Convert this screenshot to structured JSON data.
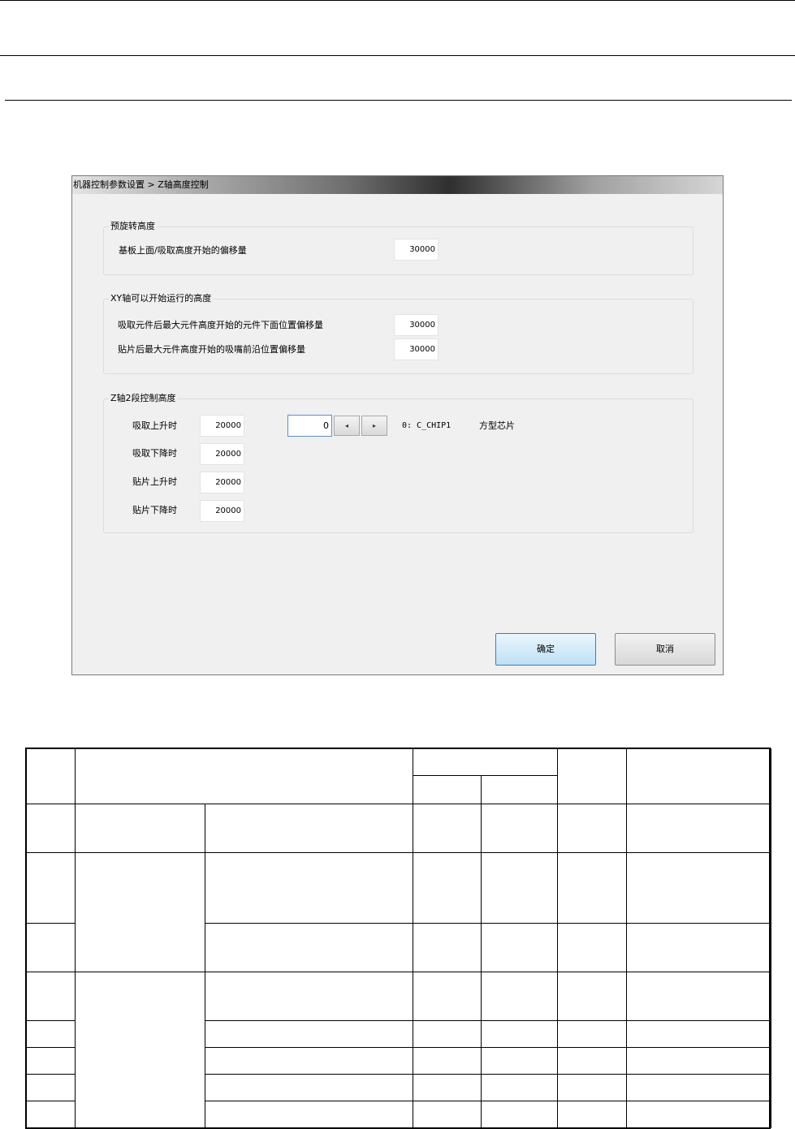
{
  "window": {
    "title": "机器控制参数设置 > Z轴高度控制"
  },
  "pre_rotation_group": {
    "label": "预旋转高度",
    "rows": [
      {
        "label": "基板上面/吸取高度开始的偏移量",
        "value": "30000"
      }
    ]
  },
  "xy_group": {
    "label": "XY轴可以开始运行的高度",
    "rows": [
      {
        "label": "吸取元件后最大元件高度开始的元件下面位置偏移量",
        "value": "30000"
      },
      {
        "label": "贴片后最大元件高度开始的吸嘴前沿位置偏移量",
        "value": "30000"
      }
    ]
  },
  "z2_group": {
    "label": "Z轴2段控制高度",
    "rows": [
      {
        "label": "吸取上升时",
        "value": "20000"
      },
      {
        "label": "吸取下降时",
        "value": "20000"
      },
      {
        "label": "贴片上升时",
        "value": "20000"
      },
      {
        "label": "贴片下降时",
        "value": "20000"
      }
    ],
    "spinner": {
      "value": "0",
      "prev_glyph": "◂",
      "next_glyph": "▸",
      "component_code": "0: C_CHIP1",
      "component_name": "方型芯片"
    }
  },
  "buttons": {
    "ok": "确定",
    "cancel": "取消"
  },
  "table": {
    "rows": 10,
    "cells_text": []
  }
}
